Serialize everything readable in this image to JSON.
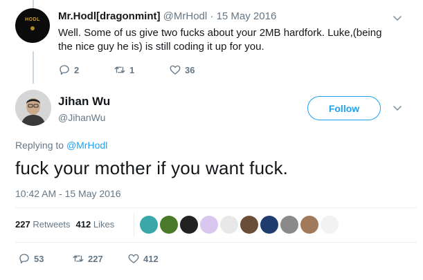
{
  "reply_tweet": {
    "avatar_text": "HODL",
    "display_name": "Mr.Hodl[dragonmint]",
    "handle": "@MrHodl",
    "separator": " · ",
    "date": "15 May 2016",
    "text": "Well. Some of us give two fucks about your 2MB hardfork. Luke,(being the nice guy he is) is still coding it up for you.",
    "reply_count": "2",
    "retweet_count": "1",
    "like_count": "36"
  },
  "main_tweet": {
    "display_name": "Jihan Wu",
    "handle": "@JihanWu",
    "follow_label": "Follow",
    "replying_prefix": "Replying to ",
    "replying_to": "@MrHodl",
    "text": "fuck your mother if you want fuck.",
    "timestamp": "10:42 AM - 15 May 2016",
    "retweets_num": "227",
    "retweets_label": "Retweets",
    "likes_num": "412",
    "likes_label": "Likes",
    "reply_count": "53",
    "retweet_count": "227",
    "like_count": "412"
  },
  "likers": [
    {
      "icon": "blue-teardrop-avatar",
      "color": "#3aa8a8"
    },
    {
      "icon": "green-gold-avatar",
      "color": "#4a7a2a"
    },
    {
      "icon": "dark-ring-avatar",
      "color": "#222222"
    },
    {
      "icon": "purple-crystal-avatar",
      "color": "#d9c7f0"
    },
    {
      "icon": "figure-avatar",
      "color": "#e8e8e8"
    },
    {
      "icon": "portrait-avatar",
      "color": "#6b4e3a"
    },
    {
      "icon": "blue-black-avatar",
      "color": "#1e3d6e"
    },
    {
      "icon": "grey-photo-avatar",
      "color": "#8a8a8a"
    },
    {
      "icon": "face-photo-avatar",
      "color": "#a07a5a"
    },
    {
      "icon": "bull-avatar",
      "color": "#f2f2f2"
    }
  ],
  "colors": {
    "accent": "#1da1f2",
    "secondary_text": "#657786",
    "primary_text": "#14171a"
  }
}
